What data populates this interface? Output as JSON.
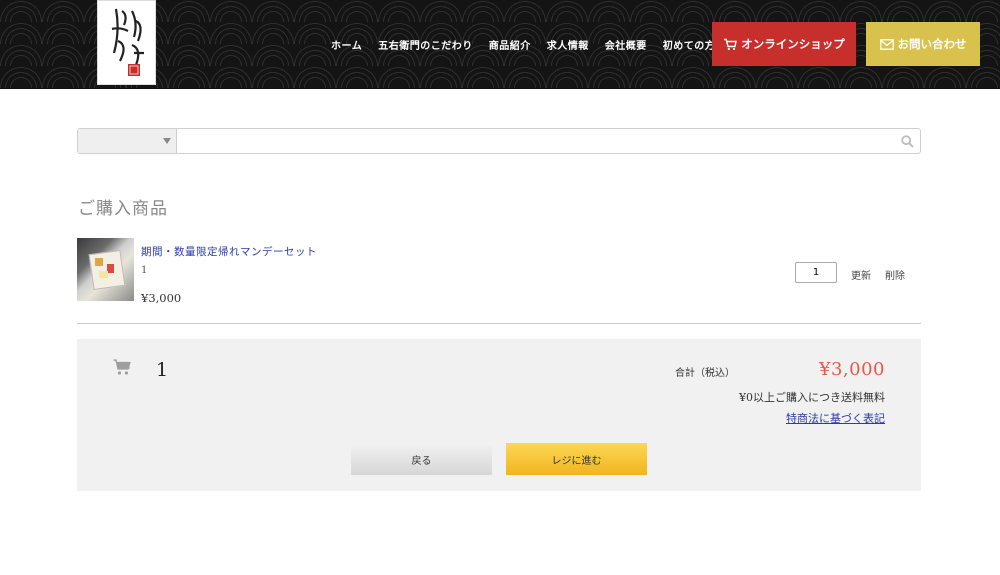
{
  "header": {
    "logo_text": "丹波大山 五右衛門",
    "nav": [
      "ホーム",
      "五右衛門のこだわり",
      "商品紹介",
      "求人情報",
      "会社概要",
      "初めての方へ"
    ],
    "shop_button": "オンラインショップ",
    "contact_button": "お問い合わせ",
    "colors": {
      "shop": "#c62f2b",
      "contact": "#d9c14d",
      "background": "#141414"
    }
  },
  "search": {
    "category_value": "",
    "query_value": "",
    "placeholder": ""
  },
  "cart": {
    "section_title": "ご購入商品",
    "items": [
      {
        "name": "期間・数量限定帰れマンデーセット",
        "quantity_text": "1",
        "price": "¥3,000",
        "quantity_input": "1",
        "update_label": "更新",
        "delete_label": "削除"
      }
    ]
  },
  "summary": {
    "item_count": "1",
    "total_label": "合計（税込）",
    "total_value": "¥3,000",
    "shipping_note": "¥0以上ご購入につき送料無料",
    "legal_link": "特商法に基づく表記",
    "back_button": "戻る",
    "checkout_button": "レジに進む",
    "colors": {
      "total": "#e8574b",
      "checkout": "#f0b51f"
    }
  }
}
